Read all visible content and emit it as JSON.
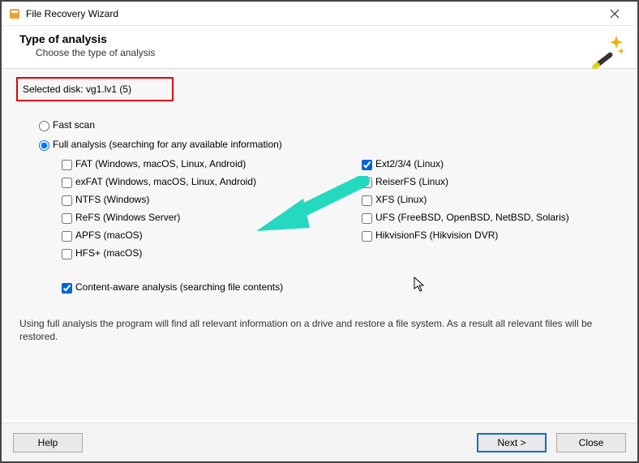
{
  "window": {
    "title": "File Recovery Wizard"
  },
  "header": {
    "title": "Type of analysis",
    "subtitle": "Choose the type of analysis"
  },
  "selected_disk": {
    "label": "Selected disk: vg1.lv1 (5)"
  },
  "scan": {
    "fast_label": "Fast scan",
    "full_label": "Full analysis (searching for any available information)",
    "selected": "full"
  },
  "filesystems": {
    "left": [
      {
        "label": "FAT (Windows, macOS, Linux, Android)",
        "checked": false
      },
      {
        "label": "exFAT (Windows, macOS, Linux, Android)",
        "checked": false
      },
      {
        "label": "NTFS (Windows)",
        "checked": false
      },
      {
        "label": "ReFS (Windows Server)",
        "checked": false
      },
      {
        "label": "APFS (macOS)",
        "checked": false
      },
      {
        "label": "HFS+ (macOS)",
        "checked": false
      }
    ],
    "right": [
      {
        "label": "Ext2/3/4 (Linux)",
        "checked": true
      },
      {
        "label": "ReiserFS (Linux)",
        "checked": false
      },
      {
        "label": "XFS (Linux)",
        "checked": false
      },
      {
        "label": "UFS (FreeBSD, OpenBSD, NetBSD, Solaris)",
        "checked": false
      },
      {
        "label": "HikvisionFS (Hikvision DVR)",
        "checked": false
      }
    ]
  },
  "content_aware": {
    "label": "Content-aware analysis (searching file contents)",
    "checked": true
  },
  "description": "Using full analysis the program will find all relevant information on a drive and restore a file system. As a result all relevant files will be restored.",
  "footer": {
    "help": "Help",
    "next": "Next >",
    "close": "Close"
  },
  "annotation": {
    "arrow_color": "#25d9c0",
    "highlight_color": "#e60000"
  }
}
